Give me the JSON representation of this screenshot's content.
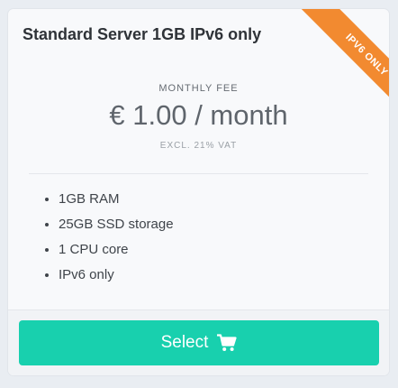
{
  "plan": {
    "title": "Standard Server 1GB IPv6 only",
    "ribbon": "IPV6 ONLY",
    "fee_label": "MONTHLY FEE",
    "price": "€ 1.00 / month",
    "vat_note": "EXCL. 21% VAT",
    "features": [
      "1GB RAM",
      "25GB SSD storage",
      "1 CPU core",
      "IPv6 only"
    ],
    "select_label": "Select",
    "select_icon": "shopping-cart-icon"
  },
  "colors": {
    "accent": "#18d0ae",
    "ribbon": "#f28a30",
    "background": "#e9edf2",
    "card": "#f8f9fb"
  }
}
